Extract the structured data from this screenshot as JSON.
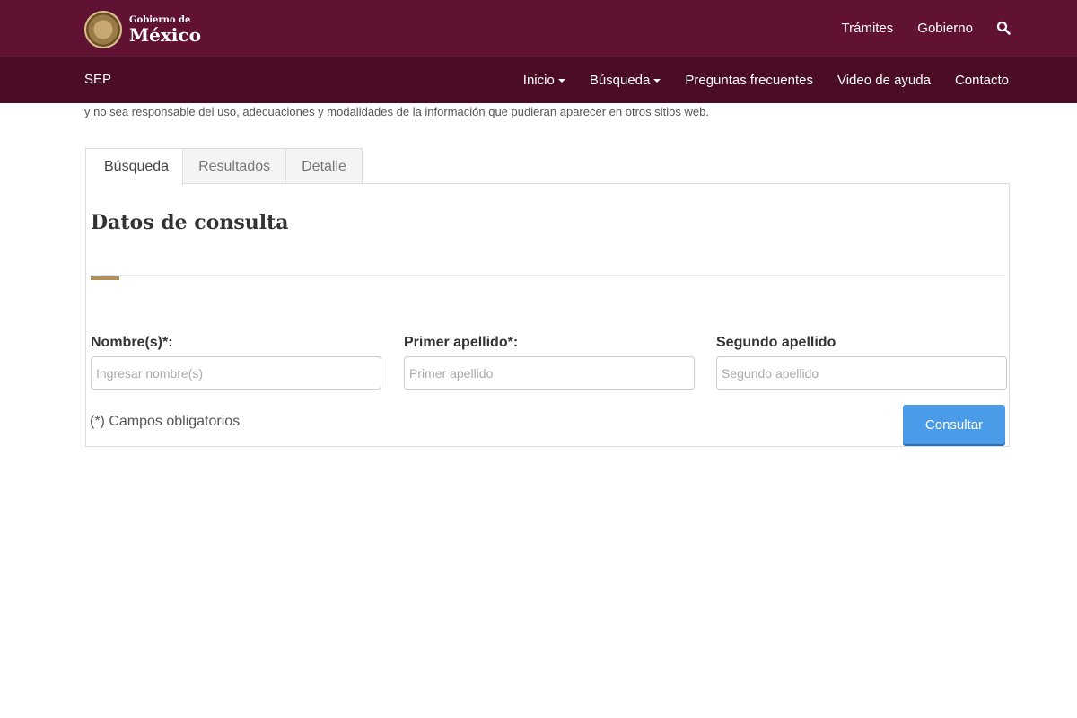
{
  "header": {
    "logo_small": "Gobierno de",
    "logo_big": "México",
    "nav": [
      "Trámites",
      "Gobierno"
    ]
  },
  "subnav": {
    "brand": "SEP",
    "items": [
      {
        "label": "Inicio",
        "dropdown": true
      },
      {
        "label": "Búsqueda",
        "dropdown": true
      },
      {
        "label": "Preguntas frecuentes",
        "dropdown": false
      },
      {
        "label": "Video de ayuda",
        "dropdown": false
      },
      {
        "label": "Contacto",
        "dropdown": false
      }
    ]
  },
  "intro": {
    "text": "y no sea responsable del uso, adecuaciones y modalidades de la información que pudieran aparecer en otros sitios web."
  },
  "tabs": [
    "Búsqueda",
    "Resultados",
    "Detalle"
  ],
  "form": {
    "title": "Datos de consulta",
    "nombre_label": "Nombre(s)*:",
    "nombre_placeholder": "Ingresar nombre(s)",
    "primer_label": "Primer apellido*:",
    "primer_placeholder": "Primer apellido",
    "segundo_label": "Segundo apellido",
    "segundo_placeholder": "Segundo apellido",
    "required_note": "(*) Campos obligatorios",
    "submit_label": "Consultar"
  },
  "colors": {
    "header_bg": "#611232",
    "subbar_bg": "#4a0d25",
    "accent": "#b38e5d",
    "button": "#4b9ce8"
  }
}
